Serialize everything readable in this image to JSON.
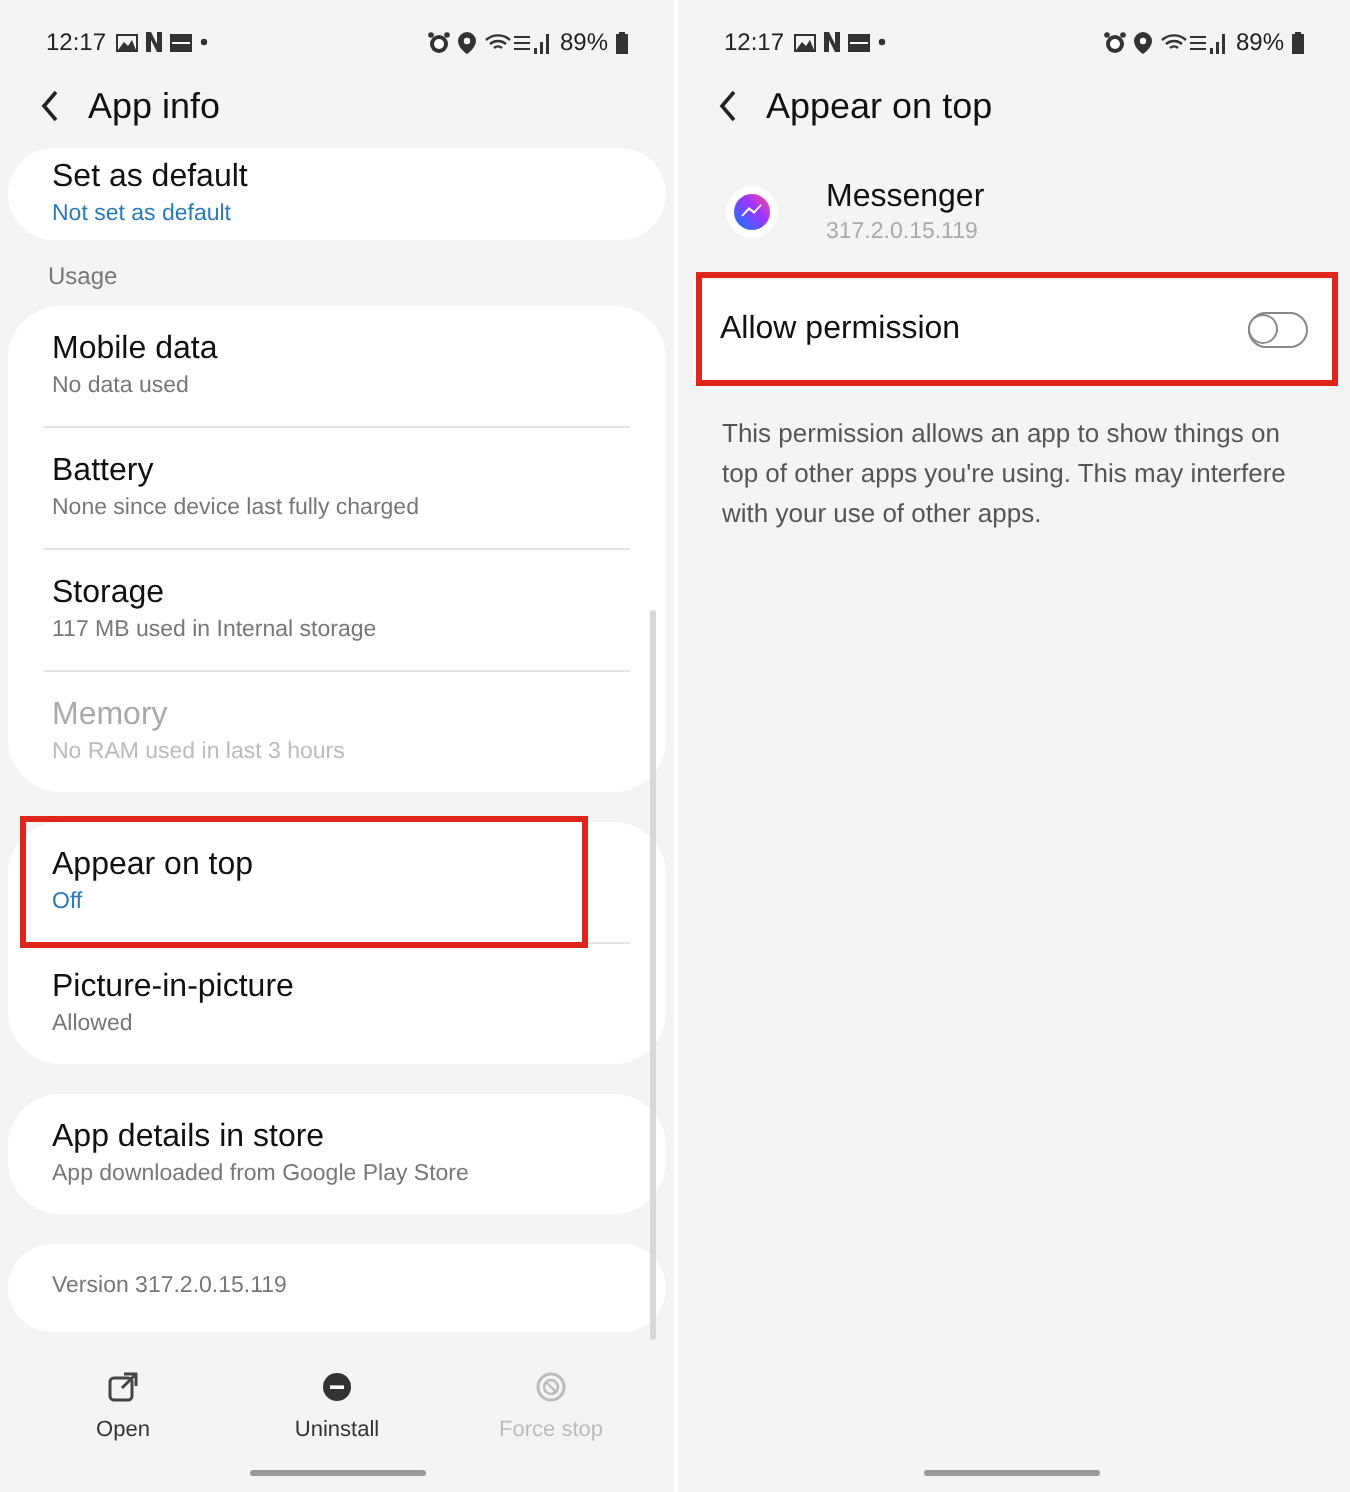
{
  "screens": [
    {
      "status_bar": {
        "time": "12:17",
        "battery": "89%"
      },
      "header": {
        "title": "App info"
      },
      "sections": [
        {
          "items": [
            {
              "title": "Set as default",
              "subtitle": "Not set as default",
              "kind": "value",
              "disabled": false,
              "highlighted": false
            }
          ]
        },
        {
          "label": "Usage",
          "items": [
            {
              "title": "Mobile data",
              "subtitle": "No data used",
              "kind": "summary",
              "disabled": false,
              "highlighted": false
            },
            {
              "title": "Battery",
              "subtitle": "None since device last fully charged",
              "kind": "summary",
              "disabled": false,
              "highlighted": false
            },
            {
              "title": "Storage",
              "subtitle": "117 MB used in Internal storage",
              "kind": "summary",
              "disabled": false,
              "highlighted": false
            },
            {
              "title": "Memory",
              "subtitle": "No RAM used in last 3 hours",
              "kind": "summary",
              "disabled": true,
              "highlighted": false
            }
          ]
        },
        {
          "items": [
            {
              "title": "Appear on top",
              "subtitle": "Off",
              "kind": "value",
              "disabled": false,
              "highlighted": true
            },
            {
              "title": "Picture-in-picture",
              "subtitle": "Allowed",
              "kind": "summary",
              "disabled": false,
              "highlighted": false
            }
          ]
        },
        {
          "items": [
            {
              "title": "App details in store",
              "subtitle": "App downloaded from Google Play Store",
              "kind": "summary",
              "disabled": false,
              "highlighted": false
            }
          ]
        },
        {
          "items": [
            {
              "note": "Version 317.2.0.15.119"
            }
          ]
        }
      ],
      "actions": [
        {
          "label": "Open",
          "kind": "open",
          "disabled": false
        },
        {
          "label": "Uninstall",
          "kind": "uninstall",
          "disabled": false
        },
        {
          "label": "Force stop",
          "kind": "stop",
          "disabled": true
        }
      ]
    },
    {
      "status_bar": {
        "time": "12:17",
        "battery": "89%"
      },
      "header": {
        "title": "Appear on top"
      },
      "app": {
        "name": "Messenger",
        "version": "317.2.0.15.119"
      },
      "permission": {
        "label": "Allow permission",
        "on": false,
        "highlighted": true
      },
      "description": "This permission allows an app to show things on top of other apps you're using. This may interfere with your use of other apps."
    }
  ]
}
